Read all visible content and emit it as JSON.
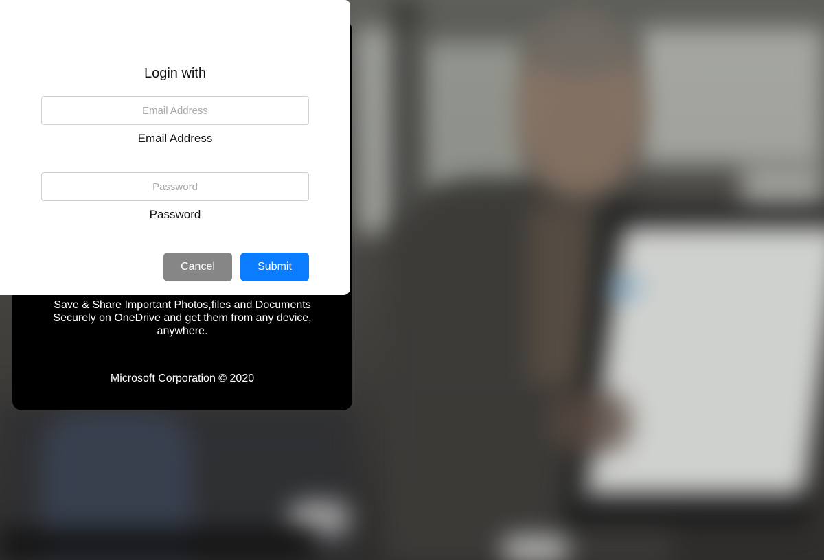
{
  "login": {
    "title": "Login with",
    "email": {
      "placeholder": "Email Address",
      "value": "",
      "label": "Email Address"
    },
    "password": {
      "placeholder": "Password",
      "value": "",
      "label": "Password"
    },
    "buttons": {
      "cancel_label": "Cancel",
      "submit_label": "Submit"
    }
  },
  "promo": {
    "lines": [
      "Save & Share Important Photos,files and Documents",
      "Securely on OneDrive and get them from any device,",
      "anywhere."
    ],
    "copyright": "Microsoft Corporation © 2020"
  },
  "colors": {
    "submit": "#0a7cff",
    "cancel": "#868686",
    "card": "#ffffff",
    "promo_card": "#000000"
  }
}
